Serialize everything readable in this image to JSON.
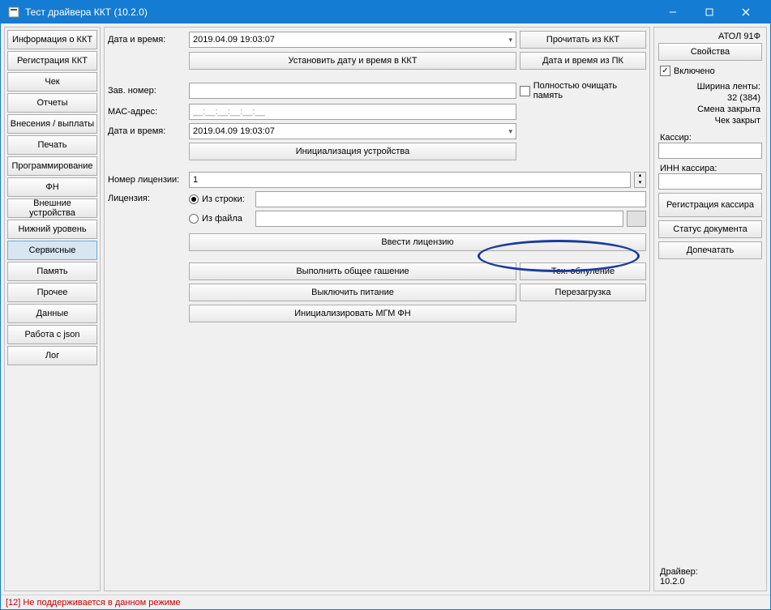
{
  "window": {
    "title": "Тест драйвера ККТ (10.2.0)"
  },
  "nav": {
    "items": [
      "Информация о ККТ",
      "Регистрация ККТ",
      "Чек",
      "Отчеты",
      "Внесения / выплаты",
      "Печать",
      "Программирование",
      "ФН",
      "Внешние устройства",
      "Нижний уровень",
      "Сервисные",
      "Память",
      "Прочее",
      "Данные",
      "Работа с json",
      "Лог"
    ],
    "active_index": 10
  },
  "center": {
    "datetime_label": "Дата и время:",
    "datetime_value": "2019.04.09 19:03:07",
    "read_kkt_btn": "Прочитать из ККТ",
    "set_datetime_btn": "Установить дату и время в ККТ",
    "datetime_pc_btn": "Дата и время из ПК",
    "serial_label": "Зав. номер:",
    "serial_value": "",
    "clear_memory_label": "Полностью очищать память",
    "mac_label": "МАС-адрес:",
    "mac_value": "__:__:__:__:__:__",
    "datetime2_label": "Дата и время:",
    "datetime2_value": "2019.04.09 19:03:07",
    "init_device_btn": "Инициализация устройства",
    "license_num_label": "Номер лицензии:",
    "license_num_value": "1",
    "license_label": "Лицензия:",
    "from_string_label": "Из строки:",
    "from_string_value": "",
    "from_file_label": "Из файла",
    "from_file_value": "",
    "enter_license_btn": "Ввести лицензию",
    "general_erase_btn": "Выполнить общее гашение",
    "tech_reset_btn": "Тех. обнуление",
    "power_off_btn": "Выключить питание",
    "reboot_btn": "Перезагрузка",
    "init_mgm_btn": "Инициализировать МГМ ФН"
  },
  "right": {
    "device": "АТОЛ 91Ф",
    "properties_btn": "Свойства",
    "enabled_label": "Включено",
    "tape_width_label": "Ширина ленты:",
    "tape_width_value": "32 (384)",
    "shift_status": "Смена закрыта",
    "receipt_status": "Чек закрыт",
    "cashier_label": "Кассир:",
    "cashier_value": "",
    "inn_label": "ИНН кассира:",
    "inn_value": "",
    "register_cashier_btn": "Регистрация кассира",
    "doc_status_btn": "Статус документа",
    "finish_print_btn": "Допечатать",
    "driver_label": "Драйвер:",
    "driver_version": "10.2.0"
  },
  "status": {
    "text": "[12] Не поддерживается в данном режиме"
  }
}
